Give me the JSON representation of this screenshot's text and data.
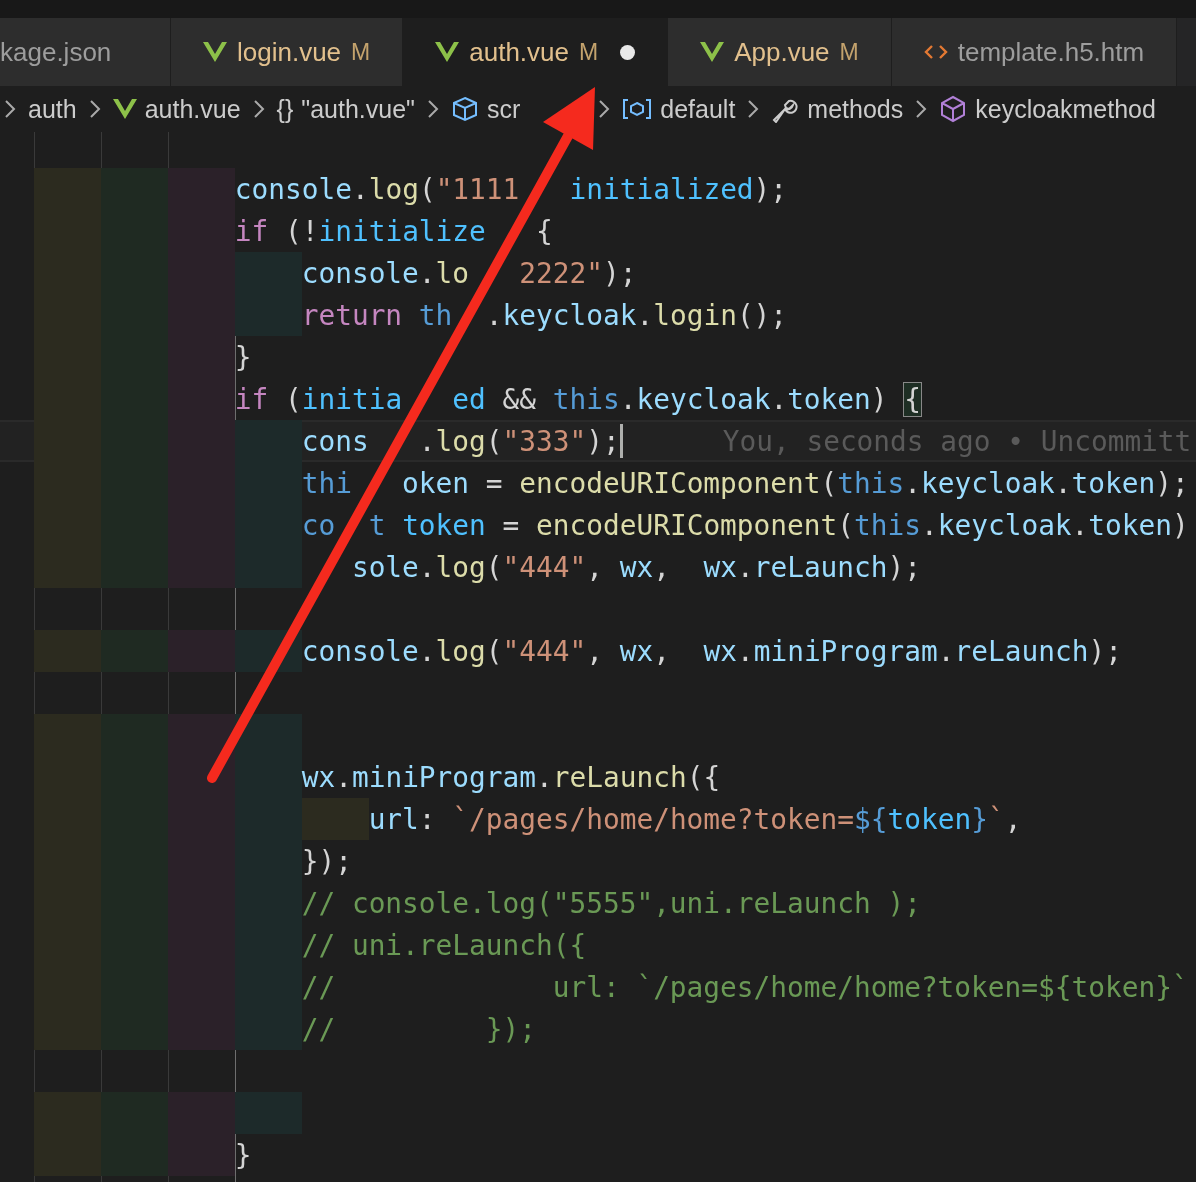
{
  "tabs": [
    {
      "label": "kage.json",
      "kind": "json",
      "selected": false,
      "dirty": false
    },
    {
      "label": "login.vue",
      "kind": "vue",
      "status": "M",
      "selected": false,
      "dirty": false
    },
    {
      "label": "auth.vue",
      "kind": "vue",
      "status": "M",
      "selected": true,
      "dirty": true
    },
    {
      "label": "App.vue",
      "kind": "vue",
      "status": "M",
      "selected": false,
      "dirty": false
    },
    {
      "label": "template.h5.htm",
      "kind": "html",
      "selected": false,
      "dirty": false
    }
  ],
  "breadcrumbs": [
    {
      "label": "auth",
      "kind": "folder"
    },
    {
      "label": "auth.vue",
      "kind": "vue"
    },
    {
      "label": "\"auth.vue\"",
      "kind": "object",
      "glyph": "{}"
    },
    {
      "label": "scr",
      "kind": "module"
    },
    {
      "label": "default",
      "kind": "namespace"
    },
    {
      "label": "methods",
      "kind": "method"
    },
    {
      "label": "keycloakmethod",
      "kind": "class"
    }
  ],
  "lines": [
    {
      "kind": "code",
      "current": false,
      "tokens": [
        {
          "kind": "variable",
          "text": "console"
        },
        {
          "kind": "punct",
          "text": "."
        },
        {
          "kind": "function",
          "text": "log"
        },
        {
          "kind": "punct",
          "text": "("
        },
        {
          "kind": "string",
          "text": "\"1111"
        },
        {
          "kind": "gap"
        },
        {
          "kind": "gap"
        },
        {
          "kind": "gap"
        },
        {
          "kind": "constant",
          "text": "initialized"
        },
        {
          "kind": "punct",
          "text": ");"
        }
      ]
    },
    {
      "kind": "code",
      "current": false,
      "tokens": [
        {
          "kind": "keyword",
          "text": "if"
        },
        {
          "kind": "punct",
          "text": " (!"
        },
        {
          "kind": "constant",
          "text": "initialize"
        },
        {
          "kind": "gap"
        },
        {
          "kind": "gap"
        },
        {
          "kind": "gap"
        },
        {
          "kind": "punct",
          "text": "{"
        }
      ],
      "children": [
        {
          "kind": "code",
          "current": false,
          "tokens": [
            {
              "kind": "variable",
              "text": "console"
            },
            {
              "kind": "punct",
              "text": "."
            },
            {
              "kind": "function",
              "text": "lo"
            },
            {
              "kind": "gap"
            },
            {
              "kind": "gap"
            },
            {
              "kind": "gap"
            },
            {
              "kind": "string",
              "text": "2222\""
            },
            {
              "kind": "punct",
              "text": ");"
            }
          ]
        },
        {
          "kind": "code",
          "current": false,
          "tokens": [
            {
              "kind": "keyword",
              "text": "return "
            },
            {
              "kind": "storage",
              "text": "th"
            },
            {
              "kind": "gap"
            },
            {
              "kind": "gap"
            },
            {
              "kind": "punct",
              "text": "."
            },
            {
              "kind": "variable",
              "text": "keycloak"
            },
            {
              "kind": "punct",
              "text": "."
            },
            {
              "kind": "function",
              "text": "login"
            },
            {
              "kind": "punct",
              "text": "();"
            }
          ]
        }
      ]
    },
    {
      "kind": "code",
      "current": false,
      "tokens": [
        {
          "kind": "punct",
          "text": "}"
        }
      ]
    },
    {
      "kind": "code",
      "current": false,
      "tokens": [
        {
          "kind": "keyword",
          "text": "if"
        },
        {
          "kind": "punct",
          "text": " ("
        },
        {
          "kind": "constant",
          "text": "initia"
        },
        {
          "kind": "gap"
        },
        {
          "kind": "gap"
        },
        {
          "kind": "gap"
        },
        {
          "kind": "constant",
          "text": "ed"
        },
        {
          "kind": "punct",
          "text": " && "
        },
        {
          "kind": "storage",
          "text": "this"
        },
        {
          "kind": "punct",
          "text": "."
        },
        {
          "kind": "variable",
          "text": "keycloak"
        },
        {
          "kind": "punct",
          "text": "."
        },
        {
          "kind": "variable",
          "text": "token"
        },
        {
          "kind": "punct",
          "text": ") "
        },
        {
          "kind": "bracket",
          "text": "{"
        }
      ],
      "children": [
        {
          "kind": "code",
          "current": true,
          "tokens": [
            {
              "kind": "variable",
              "text": "cons"
            },
            {
              "kind": "gap"
            },
            {
              "kind": "gap"
            },
            {
              "kind": "gap"
            },
            {
              "kind": "punct",
              "text": "."
            },
            {
              "kind": "function",
              "text": "log"
            },
            {
              "kind": "punct",
              "text": "("
            },
            {
              "kind": "string",
              "text": "\"333\""
            },
            {
              "kind": "punct",
              "text": ");"
            }
          ],
          "blame": "You, seconds ago • Uncommitt"
        },
        {
          "kind": "code",
          "current": false,
          "tokens": [
            {
              "kind": "storage",
              "text": "thi"
            },
            {
              "kind": "gap"
            },
            {
              "kind": "gap"
            },
            {
              "kind": "gap"
            },
            {
              "kind": "variable",
              "text": "oken"
            },
            {
              "kind": "punct",
              "text": " = "
            },
            {
              "kind": "function",
              "text": "encodeURIComponent"
            },
            {
              "kind": "punct",
              "text": "("
            },
            {
              "kind": "storage",
              "text": "this"
            },
            {
              "kind": "punct",
              "text": "."
            },
            {
              "kind": "variable",
              "text": "keycloak"
            },
            {
              "kind": "punct",
              "text": "."
            },
            {
              "kind": "variable",
              "text": "token"
            },
            {
              "kind": "punct",
              "text": ");"
            }
          ]
        },
        {
          "kind": "code",
          "current": false,
          "tokens": [
            {
              "kind": "storage",
              "text": "co"
            },
            {
              "kind": "gap"
            },
            {
              "kind": "gap"
            },
            {
              "kind": "storage",
              "text": "t "
            },
            {
              "kind": "constant",
              "text": "token"
            },
            {
              "kind": "punct",
              "text": " = "
            },
            {
              "kind": "function",
              "text": "encodeURIComponent"
            },
            {
              "kind": "punct",
              "text": "("
            },
            {
              "kind": "storage",
              "text": "this"
            },
            {
              "kind": "punct",
              "text": "."
            },
            {
              "kind": "variable",
              "text": "keycloak"
            },
            {
              "kind": "punct",
              "text": "."
            },
            {
              "kind": "variable",
              "text": "token"
            },
            {
              "kind": "punct",
              "text": ")"
            }
          ]
        },
        {
          "kind": "code",
          "current": false,
          "tokens": [
            {
              "kind": "gap"
            },
            {
              "kind": "gap"
            },
            {
              "kind": "gap"
            },
            {
              "kind": "variable",
              "text": "sole"
            },
            {
              "kind": "punct",
              "text": "."
            },
            {
              "kind": "function",
              "text": "log"
            },
            {
              "kind": "punct",
              "text": "("
            },
            {
              "kind": "string",
              "text": "\"444\""
            },
            {
              "kind": "punct",
              "text": ", "
            },
            {
              "kind": "variable",
              "text": "wx"
            },
            {
              "kind": "punct",
              "text": ",  "
            },
            {
              "kind": "variable",
              "text": "wx"
            },
            {
              "kind": "punct",
              "text": "."
            },
            {
              "kind": "variable",
              "text": "reLaunch"
            },
            {
              "kind": "punct",
              "text": ");"
            }
          ]
        },
        {
          "kind": "empty",
          "current": false
        },
        {
          "kind": "code",
          "current": false,
          "tokens": [
            {
              "kind": "variable",
              "text": "console"
            },
            {
              "kind": "punct",
              "text": "."
            },
            {
              "kind": "function",
              "text": "log"
            },
            {
              "kind": "punct",
              "text": "("
            },
            {
              "kind": "string",
              "text": "\"444\""
            },
            {
              "kind": "punct",
              "text": ", "
            },
            {
              "kind": "variable",
              "text": "wx"
            },
            {
              "kind": "punct",
              "text": ",  "
            },
            {
              "kind": "variable",
              "text": "wx"
            },
            {
              "kind": "punct",
              "text": "."
            },
            {
              "kind": "variable",
              "text": "miniProgram"
            },
            {
              "kind": "punct",
              "text": "."
            },
            {
              "kind": "variable",
              "text": "reLaunch"
            },
            {
              "kind": "punct",
              "text": ");"
            }
          ]
        },
        {
          "kind": "empty",
          "current": false
        },
        {
          "kind": "whitespace",
          "current": false
        },
        {
          "kind": "code",
          "current": false,
          "tokens": [
            {
              "kind": "variable",
              "text": "wx"
            },
            {
              "kind": "punct",
              "text": "."
            },
            {
              "kind": "variable",
              "text": "miniProgram"
            },
            {
              "kind": "punct",
              "text": "."
            },
            {
              "kind": "function",
              "text": "reLaunch"
            },
            {
              "kind": "punct",
              "text": "({"
            }
          ],
          "children": [
            {
              "kind": "code",
              "current": false,
              "tokens": [
                {
                  "kind": "variable",
                  "text": "url"
                },
                {
                  "kind": "punct",
                  "text": ": "
                },
                {
                  "kind": "string",
                  "text": "`/pages/home/home?token="
                },
                {
                  "kind": "storage",
                  "text": "${"
                },
                {
                  "kind": "constant",
                  "text": "token"
                },
                {
                  "kind": "storage",
                  "text": "}"
                },
                {
                  "kind": "string",
                  "text": "`"
                },
                {
                  "kind": "punct",
                  "text": ","
                }
              ]
            }
          ]
        },
        {
          "kind": "code",
          "current": false,
          "tokens": [
            {
              "kind": "punct",
              "text": "});"
            }
          ]
        },
        {
          "kind": "code",
          "current": false,
          "tokens": [
            {
              "kind": "comment",
              "text": "// console.log(\"5555\",uni.reLaunch );"
            }
          ]
        },
        {
          "kind": "code",
          "current": false,
          "tokens": [
            {
              "kind": "comment",
              "text": "// uni.reLaunch({"
            }
          ]
        },
        {
          "kind": "code",
          "current": false,
          "tokens": [
            {
              "kind": "comment",
              "text": "//             url: `/pages/home/home?token=${token}`"
            }
          ]
        },
        {
          "kind": "code",
          "current": false,
          "tokens": [
            {
              "kind": "comment",
              "text": "//         });"
            }
          ]
        },
        {
          "kind": "empty",
          "current": false
        },
        {
          "kind": "whitespace",
          "current": false
        }
      ]
    },
    {
      "kind": "code",
      "current": false,
      "tokens": [
        {
          "kind": "punct",
          "text": "}"
        }
      ]
    }
  ]
}
